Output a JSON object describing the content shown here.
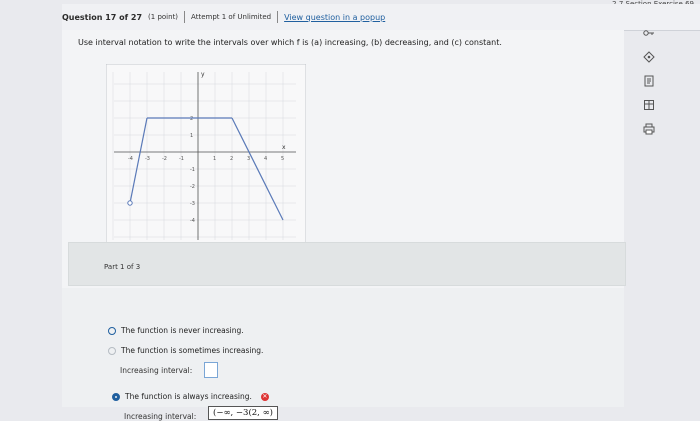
{
  "corner_title": "2.7 Section Exercise 69",
  "header": {
    "question_number": "Question 17 of 27",
    "points": "(1 point)",
    "attempt": "Attempt 1 of Unlimited",
    "popup_link": "View question in a popup"
  },
  "question": {
    "text": "Use interval notation to write the intervals over which f is (a) increasing, (b) decreasing, and (c) constant."
  },
  "graph": {
    "x_label": "x",
    "y_label": "y",
    "x_ticks": [
      "-4",
      "-3",
      "-2",
      "-1",
      "1",
      "2",
      "3",
      "4",
      "5"
    ],
    "y_ticks": [
      "2",
      "1",
      "-1",
      "-2",
      "-3",
      "-4"
    ],
    "segments": [
      {
        "from": [
          -4,
          -3
        ],
        "to": [
          -3,
          2
        ]
      },
      {
        "from": [
          -3,
          2
        ],
        "to": [
          2,
          2
        ]
      },
      {
        "from": [
          2,
          2
        ],
        "to": [
          5,
          -4
        ]
      }
    ],
    "open_point": [
      -4,
      -3
    ]
  },
  "part": {
    "label": "Part 1 of 3"
  },
  "options": [
    {
      "label": "The function is never increasing."
    },
    {
      "label": "The function is sometimes increasing."
    },
    {
      "label": "The function is always increasing."
    }
  ],
  "increasing_interval_label_1": "Increasing interval:",
  "increasing_interval_label_2": "Increasing interval:",
  "answer_value": "(−∞, −3(2, ∞)",
  "toolbar": {
    "items": [
      "key-icon",
      "diamond-icon",
      "sheet-icon",
      "table-icon",
      "print-icon"
    ]
  }
}
